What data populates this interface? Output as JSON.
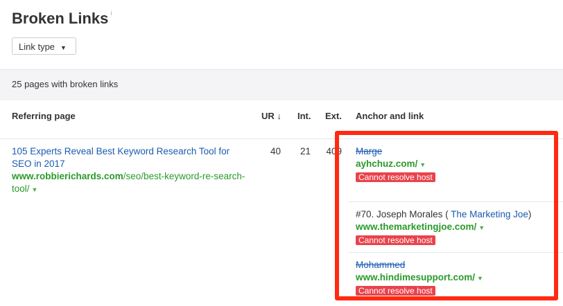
{
  "header": {
    "title": "Broken Links",
    "info": "i",
    "filter_label": "Link type"
  },
  "summary": "25 pages with broken links",
  "columns": {
    "referring": "Referring page",
    "ur": "UR",
    "int": "Int.",
    "ext": "Ext.",
    "anchor": "Anchor and link"
  },
  "row": {
    "title": "105 Experts Reveal Best Keyword Research Tool for SEO in 2017",
    "domain": "www.robbierichards.com",
    "path": "/seo/best-keyword-re-search-tool/",
    "ur": "40",
    "int": "21",
    "ext": "409",
    "links": [
      {
        "anchor": "Marge",
        "url": "ayhchuz.com/",
        "status": "Cannot resolve host"
      },
      {
        "anchor_prefix": "#70. Joseph Morales (",
        "anchor_link": " The Marketing Joe",
        "anchor_suffix": ")",
        "url": "www.themarketingjoe.com/",
        "status": "Cannot resolve host"
      },
      {
        "anchor": "Mohammed",
        "url": "www.hindimesupport.com/",
        "status": "Cannot resolve host"
      }
    ]
  },
  "colors": {
    "highlight": "#ff2a12",
    "badge": "#e9434b",
    "link": "#1a5bb0",
    "url": "#2a9a2a"
  }
}
